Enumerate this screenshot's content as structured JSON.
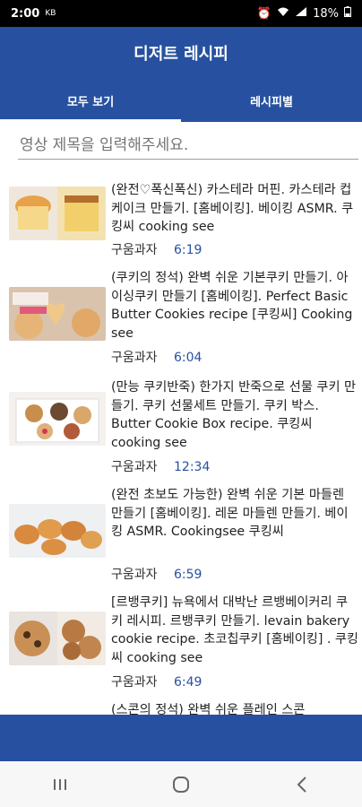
{
  "status": {
    "time": "2:00",
    "battery": "18%"
  },
  "app": {
    "title": "디저트 레시피"
  },
  "tabs": [
    {
      "label": "모두 보기"
    },
    {
      "label": "레시피별"
    }
  ],
  "search": {
    "placeholder": "영상 제목을 입력해주세요."
  },
  "videos": [
    {
      "title": "(완전♡폭신폭신) 카스테라 머핀. 카스테라 컵케이크 만들기. [홈베이킹]. 베이킹 ASMR. 쿠킹씨 cooking see",
      "channel": "구움과자",
      "duration": "6:19"
    },
    {
      "title": "(쿠키의 정석) 완벽 쉬운 기본쿠키 만들기. 아이싱쿠키 만들기 [홈베이킹]. Perfect Basic Butter Cookies recipe [쿠킹씨] Cooking see",
      "channel": "구움과자",
      "duration": "6:04"
    },
    {
      "title": "(만능 쿠키반죽) 한가지 반죽으로 선물 쿠키 만들기. 쿠키 선물세트 만들기. 쿠키 박스. Butter Cookie Box recipe. 쿠킹씨 cooking see",
      "channel": "구움과자",
      "duration": "12:34"
    },
    {
      "title": "(완전 초보도 가능한) 완벽 쉬운 기본 마들렌 만들기 [홈베이킹]. 레몬 마들렌 만들기. 베이킹 ASMR. Cookingsee 쿠킹씨",
      "channel": "구움과자",
      "duration": "6:59"
    },
    {
      "title": "[르뱅쿠키] 뉴욕에서 대박난 르뱅베이커리 쿠키 레시피. 르뱅쿠키 만들기. levain bakery cookie recipe. 초코칩쿠키 [홈베이킹] . 쿠킹씨 cooking see",
      "channel": "구움과자",
      "duration": "6:49"
    },
    {
      "title": "(스콘의 정석) 완벽 쉬운 플레인 스콘",
      "channel": "",
      "duration": ""
    }
  ]
}
